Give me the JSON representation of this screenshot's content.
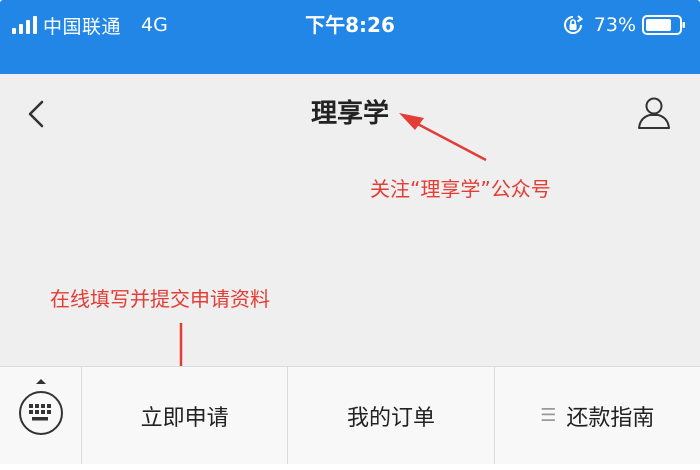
{
  "status_bar": {
    "carrier": "中国联通",
    "network": "4G",
    "time": "下午8:26",
    "battery": "73%"
  },
  "nav": {
    "title": "理享学"
  },
  "annotations": {
    "follow_note": "关注“理享学”公众号",
    "apply_note": "在线填写并提交申请资料"
  },
  "menu": {
    "items": [
      {
        "label": "立即申请"
      },
      {
        "label": "我的订单"
      },
      {
        "label": "还款指南",
        "icon": "menu-lines-icon"
      }
    ]
  },
  "colors": {
    "status_bar_bg": "#2186e5",
    "page_bg": "#efefef",
    "annotation": "#e23d36"
  }
}
